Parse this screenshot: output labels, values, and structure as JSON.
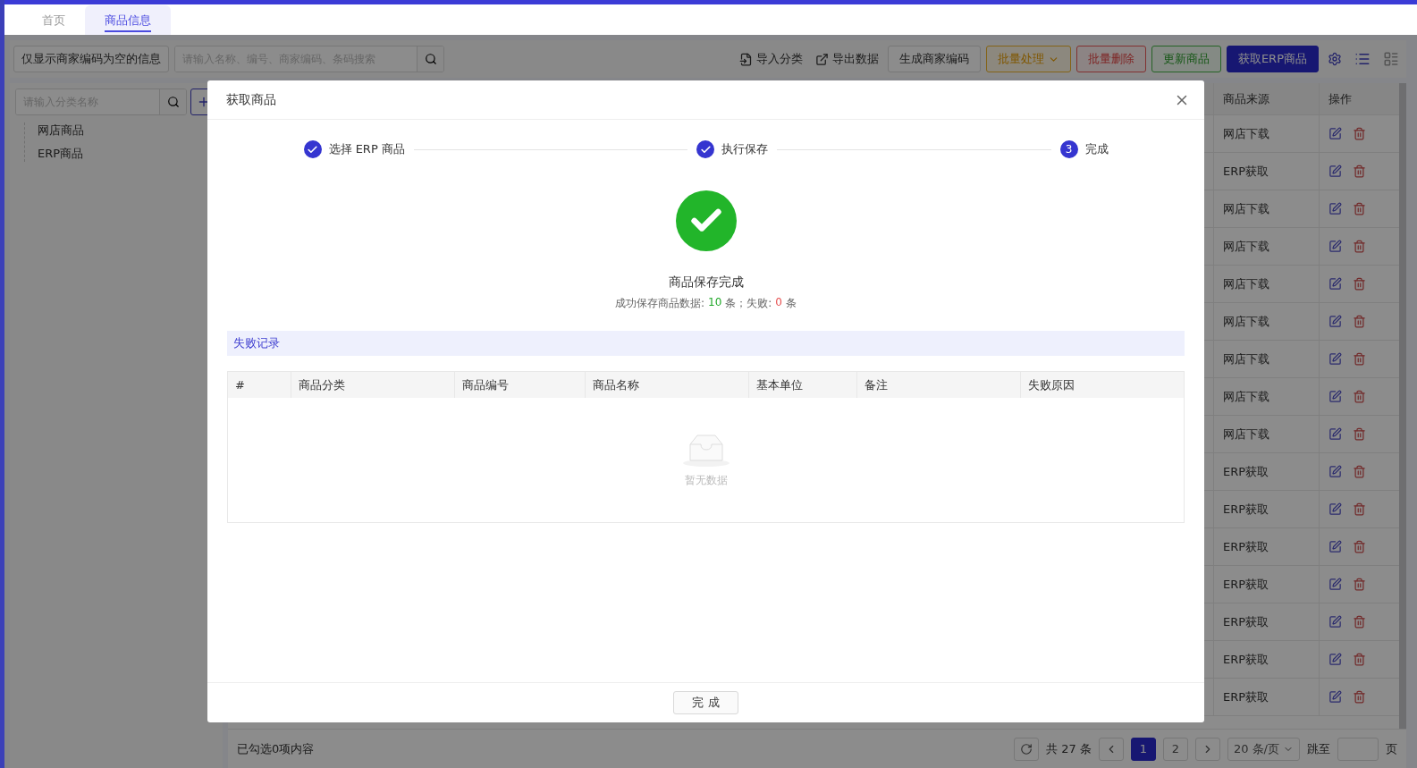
{
  "tabs": [
    {
      "label": "首页",
      "selected": false
    },
    {
      "label": "商品信息",
      "selected": true
    }
  ],
  "toolbar": {
    "filter_button": "仅显示商家编码为空的信息",
    "search_placeholder": "请输入名称、编号、商家编码、条码搜索",
    "links": [
      {
        "kind": "import",
        "label": "导入分类"
      },
      {
        "kind": "export",
        "label": "导出数据"
      }
    ],
    "buttons": [
      {
        "label": "生成商家编码",
        "kind": "default",
        "dropdown": false
      },
      {
        "label": "批量处理",
        "kind": "warning",
        "dropdown": true
      },
      {
        "label": "批量删除",
        "kind": "danger",
        "dropdown": false
      },
      {
        "label": "更新商品",
        "kind": "success",
        "dropdown": false
      },
      {
        "label": "获取ERP商品",
        "kind": "primary",
        "dropdown": false
      }
    ]
  },
  "sidebar": {
    "search_placeholder": "请输入分类名称",
    "tree": [
      "网店商品",
      "ERP商品"
    ]
  },
  "table": {
    "columns": [
      "商品来源",
      "操作"
    ],
    "rows": [
      "网店下载",
      "ERP获取",
      "网店下载",
      "网店下载",
      "网店下载",
      "网店下载",
      "网店下载",
      "网店下载",
      "网店下载",
      "ERP获取",
      "ERP获取",
      "ERP获取",
      "ERP获取",
      "ERP获取",
      "ERP获取",
      "ERP获取"
    ]
  },
  "footer": {
    "selection": "已勾选0项内容",
    "total": "共 27 条",
    "pages": [
      {
        "label": "1",
        "selected": true
      },
      {
        "label": "2",
        "selected": false
      }
    ],
    "page_size": "20 条/页",
    "jump_label": "跳至",
    "page_unit": "页"
  },
  "dialog": {
    "title": "获取商品",
    "steps": [
      {
        "label": "选择 ERP 商品",
        "done": true
      },
      {
        "label": "执行保存",
        "done": true
      },
      {
        "label": "完成",
        "number": "3",
        "done": false
      }
    ],
    "result_title": "商品保存完成",
    "summary": {
      "prefix": "成功保存商品数据:",
      "success": "10",
      "middle": "条；失败:",
      "fail": "0",
      "suffix": "条"
    },
    "failure_title": "失败记录",
    "failure_columns": [
      "#",
      "商品分类",
      "商品编号",
      "商品名称",
      "基本单位",
      "备注",
      "失败原因"
    ],
    "empty_text": "暂无数据",
    "finish_button": "完 成"
  }
}
